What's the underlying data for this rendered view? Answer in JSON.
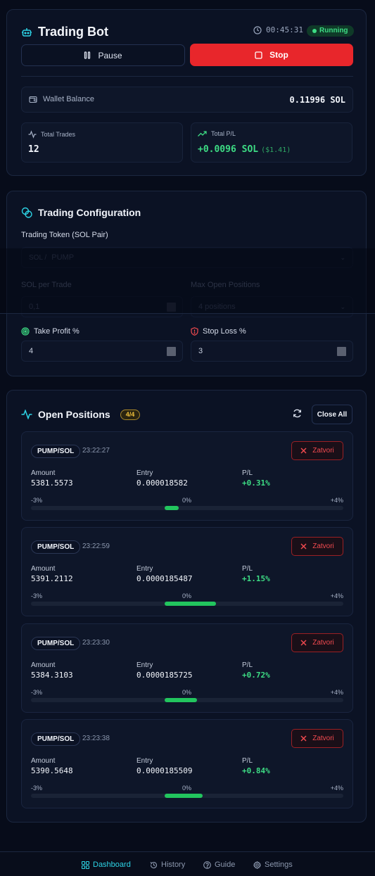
{
  "bot": {
    "title": "Trading Bot",
    "elapsed": "00:45:31",
    "status": "Running",
    "pause_label": "Pause",
    "stop_label": "Stop",
    "wallet_label": "Wallet Balance",
    "wallet_value": "0.11996 SOL",
    "total_trades_label": "Total Trades",
    "total_trades_value": "12",
    "total_pl_label": "Total P/L",
    "total_pl_value": "+0.0096 SOL",
    "total_pl_usd": "($1.41)"
  },
  "config": {
    "title": "Trading Configuration",
    "token_label": "Trading Token (SOL Pair)",
    "token_prefix": "SOL /",
    "token_value": "PUMP",
    "sol_per_trade_label": "SOL per Trade",
    "sol_per_trade_value": "0,1",
    "max_positions_label": "Max Open Positions",
    "max_positions_value": "4 positions",
    "take_profit_label": "Take Profit %",
    "take_profit_value": "4",
    "stop_loss_label": "Stop Loss %",
    "stop_loss_value": "3"
  },
  "positions": {
    "title": "Open Positions",
    "count": "4/4",
    "close_all_label": "Close All",
    "amount_label": "Amount",
    "entry_label": "Entry",
    "pl_label": "P/L",
    "close_label": "Zatvori",
    "scale_min": "-3%",
    "scale_mid": "0%",
    "scale_max": "+4%",
    "items": [
      {
        "pair": "PUMP/SOL",
        "time": "23:22:27",
        "amount": "5381.5573",
        "entry": "0.000018582",
        "pl": "+0.31%",
        "pl_value": 0.31
      },
      {
        "pair": "PUMP/SOL",
        "time": "23:22:59",
        "amount": "5391.2112",
        "entry": "0.0000185487",
        "pl": "+1.15%",
        "pl_value": 1.15
      },
      {
        "pair": "PUMP/SOL",
        "time": "23:23:30",
        "amount": "5384.3103",
        "entry": "0.0000185725",
        "pl": "+0.72%",
        "pl_value": 0.72
      },
      {
        "pair": "PUMP/SOL",
        "time": "23:23:38",
        "amount": "5390.5648",
        "entry": "0.0000185509",
        "pl": "+0.84%",
        "pl_value": 0.84
      }
    ],
    "range_min": -3,
    "range_max": 4
  },
  "nav": {
    "dashboard": "Dashboard",
    "history": "History",
    "guide": "Guide",
    "settings": "Settings"
  },
  "colors": {
    "accent": "#2dd4e6",
    "positive": "#22c55e",
    "danger": "#e8262b",
    "warning": "#f2c23c"
  }
}
